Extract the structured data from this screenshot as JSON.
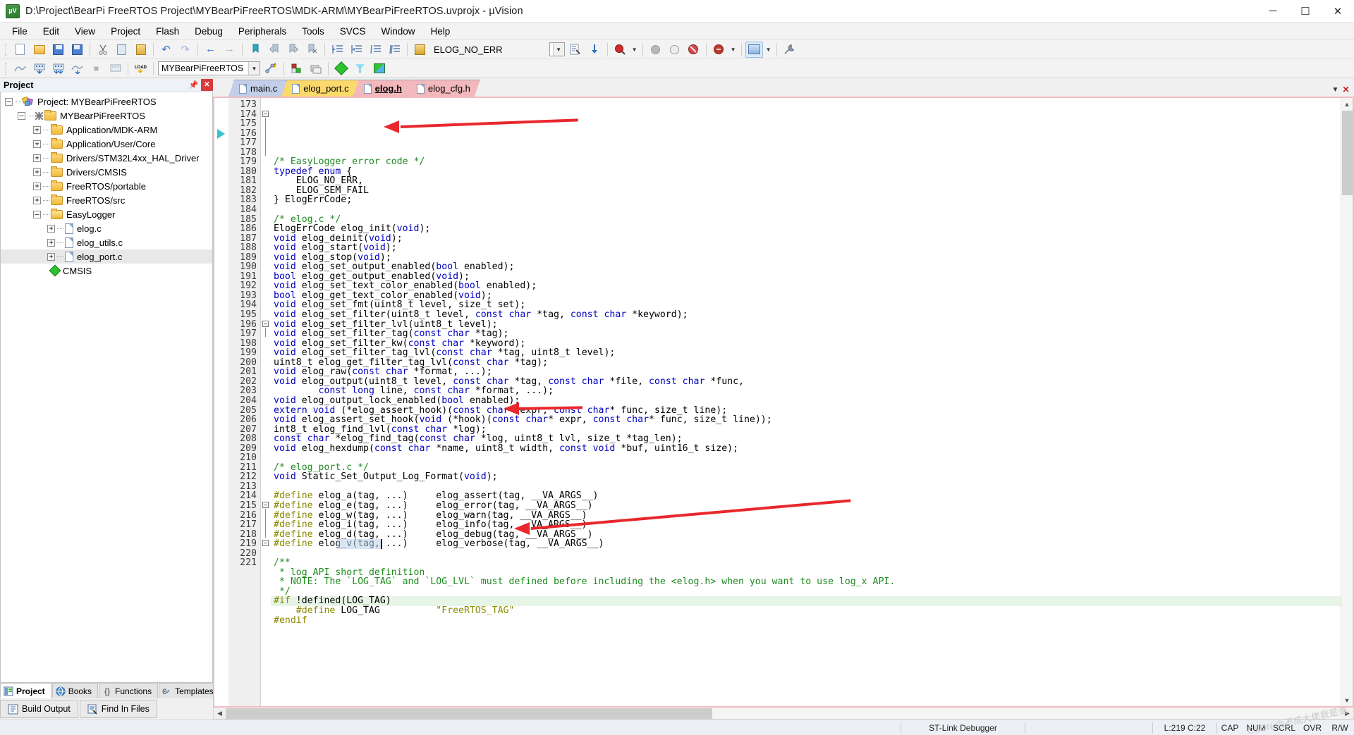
{
  "window": {
    "title": "D:\\Project\\BearPi FreeRTOS Project\\MYBearPiFreeRTOS\\MDK-ARM\\MYBearPiFreeRTOS.uvprojx - µVision",
    "app_icon": "uvision-icon",
    "minimize": "─",
    "maximize": "☐",
    "close": "✕"
  },
  "menu": {
    "items": [
      "File",
      "Edit",
      "View",
      "Project",
      "Flash",
      "Debug",
      "Peripherals",
      "Tools",
      "SVCS",
      "Window",
      "Help"
    ]
  },
  "toolbar1": {
    "find_combo_value": "ELOG_NO_ERR",
    "buttons": [
      "new-file-icon",
      "open-file-icon",
      "save-icon",
      "save-all-icon",
      "cut-icon",
      "copy-icon",
      "paste-icon",
      "undo-icon",
      "redo-icon",
      "navigate-back-icon",
      "navigate-forward-icon",
      "insert-bookmark-icon",
      "prev-bookmark-icon",
      "next-bookmark-icon",
      "clear-bookmarks-icon",
      "indent-icon",
      "outdent-icon",
      "comment-icon",
      "uncomment-icon",
      "find-in-files-icon"
    ],
    "right_buttons": [
      "bookmark-list-icon",
      "jump-icon",
      "magnifier-icon",
      "dropdown-caret-icon",
      "breakpoint-disabled-icon",
      "breakpoint-empty-icon",
      "breakpoint-kill-icon",
      "debug-icon",
      "window-layout-icon",
      "configure-icon"
    ]
  },
  "toolbar2": {
    "target_combo_value": "MYBearPiFreeRTOS",
    "buttons": [
      "translate-icon",
      "build-icon",
      "rebuild-icon",
      "batch-build-icon",
      "stop-build-icon",
      "download-icon",
      "target-options-icon",
      "manage-runtime-icon",
      "debug-start-icon",
      "registers-icon",
      "diamond-green-icon",
      "funnel-icon",
      "multi-project-icon"
    ]
  },
  "project_panel": {
    "header": "Project",
    "pin_icon": "pin-icon",
    "close_icon": "close-icon",
    "tree": [
      {
        "label": "Project: MYBearPiFreeRTOS",
        "depth": 0,
        "expander": "-",
        "icon": "project-icon"
      },
      {
        "label": "MYBearPiFreeRTOS",
        "depth": 1,
        "expander": "-",
        "icon": "target-folder-icon"
      },
      {
        "label": "Application/MDK-ARM",
        "depth": 2,
        "expander": "+",
        "icon": "folder-icon"
      },
      {
        "label": "Application/User/Core",
        "depth": 2,
        "expander": "+",
        "icon": "folder-icon"
      },
      {
        "label": "Drivers/STM32L4xx_HAL_Driver",
        "depth": 2,
        "expander": "+",
        "icon": "folder-icon"
      },
      {
        "label": "Drivers/CMSIS",
        "depth": 2,
        "expander": "+",
        "icon": "folder-icon"
      },
      {
        "label": "FreeRTOS/portable",
        "depth": 2,
        "expander": "+",
        "icon": "folder-icon"
      },
      {
        "label": "FreeRTOS/src",
        "depth": 2,
        "expander": "+",
        "icon": "folder-icon"
      },
      {
        "label": "EasyLogger",
        "depth": 2,
        "expander": "-",
        "icon": "folder-open-icon"
      },
      {
        "label": "elog.c",
        "depth": 3,
        "expander": "+",
        "icon": "file-icon"
      },
      {
        "label": "elog_utils.c",
        "depth": 3,
        "expander": "+",
        "icon": "file-icon"
      },
      {
        "label": "elog_port.c",
        "depth": 3,
        "expander": "+",
        "icon": "file-icon",
        "selected": true
      },
      {
        "label": "CMSIS",
        "depth": 2,
        "expander": "",
        "icon": "cmsis-icon"
      }
    ],
    "bottom_tabs": [
      {
        "label": "Project",
        "icon": "project-tab-icon",
        "active": true
      },
      {
        "label": "Books",
        "icon": "books-tab-icon",
        "active": false
      },
      {
        "label": "Functions",
        "icon": "functions-tab-icon",
        "active": false
      },
      {
        "label": "Templates",
        "icon": "templates-tab-icon",
        "active": false
      }
    ]
  },
  "editor": {
    "tabs": [
      {
        "label": "main.c",
        "state": "inactive",
        "color": "#c3cfe8"
      },
      {
        "label": "elog_port.c",
        "state": "inactive",
        "color": "#fbd96b"
      },
      {
        "label": "elog.h",
        "state": "active",
        "color": "#f2b8bc"
      },
      {
        "label": "elog_cfg.h",
        "state": "inactive",
        "color": "#f2b8bc"
      }
    ],
    "tab_nav": {
      "down": "▼",
      "close": "✕"
    },
    "first_line": 173,
    "highlight_line": 219,
    "lines": [
      {
        "n": 173,
        "tokens": [
          [
            "cm",
            "/* EasyLogger error code */"
          ]
        ]
      },
      {
        "n": 174,
        "fold": "-",
        "tokens": [
          [
            "kw",
            "typedef"
          ],
          [
            "pl",
            " "
          ],
          [
            "kw",
            "enum"
          ],
          [
            "pl",
            " {"
          ]
        ]
      },
      {
        "n": 175,
        "tokens": [
          [
            "pl",
            "    ELOG_NO_ERR,"
          ]
        ]
      },
      {
        "n": 176,
        "tokens": [
          [
            "pl",
            "    ELOG_SEM_FAIL"
          ]
        ]
      },
      {
        "n": 177,
        "tokens": [
          [
            "pl",
            "} ElogErrCode;"
          ]
        ]
      },
      {
        "n": 178,
        "tokens": []
      },
      {
        "n": 179,
        "tokens": [
          [
            "cm",
            "/* elog.c */"
          ]
        ]
      },
      {
        "n": 180,
        "tokens": [
          [
            "pl",
            "ElogErrCode elog_init("
          ],
          [
            "kw",
            "void"
          ],
          [
            "pl",
            ");"
          ]
        ]
      },
      {
        "n": 181,
        "tokens": [
          [
            "kw",
            "void"
          ],
          [
            "pl",
            " elog_deinit("
          ],
          [
            "kw",
            "void"
          ],
          [
            "pl",
            ");"
          ]
        ]
      },
      {
        "n": 182,
        "tokens": [
          [
            "kw",
            "void"
          ],
          [
            "pl",
            " elog_start("
          ],
          [
            "kw",
            "void"
          ],
          [
            "pl",
            ");"
          ]
        ]
      },
      {
        "n": 183,
        "tokens": [
          [
            "kw",
            "void"
          ],
          [
            "pl",
            " elog_stop("
          ],
          [
            "kw",
            "void"
          ],
          [
            "pl",
            ");"
          ]
        ]
      },
      {
        "n": 184,
        "tokens": [
          [
            "kw",
            "void"
          ],
          [
            "pl",
            " elog_set_output_enabled("
          ],
          [
            "kw",
            "bool"
          ],
          [
            "pl",
            " enabled);"
          ]
        ]
      },
      {
        "n": 185,
        "tokens": [
          [
            "kw",
            "bool"
          ],
          [
            "pl",
            " elog_get_output_enabled("
          ],
          [
            "kw",
            "void"
          ],
          [
            "pl",
            ");"
          ]
        ]
      },
      {
        "n": 186,
        "tokens": [
          [
            "kw",
            "void"
          ],
          [
            "pl",
            " elog_set_text_color_enabled("
          ],
          [
            "kw",
            "bool"
          ],
          [
            "pl",
            " enabled);"
          ]
        ]
      },
      {
        "n": 187,
        "tokens": [
          [
            "kw",
            "bool"
          ],
          [
            "pl",
            " elog_get_text_color_enabled("
          ],
          [
            "kw",
            "void"
          ],
          [
            "pl",
            ");"
          ]
        ]
      },
      {
        "n": 188,
        "tokens": [
          [
            "kw",
            "void"
          ],
          [
            "pl",
            " elog_set_fmt(uint8_t level, size_t set);"
          ]
        ]
      },
      {
        "n": 189,
        "tokens": [
          [
            "kw",
            "void"
          ],
          [
            "pl",
            " elog_set_filter(uint8_t level, "
          ],
          [
            "kw",
            "const char"
          ],
          [
            "pl",
            " *tag, "
          ],
          [
            "kw",
            "const char"
          ],
          [
            "pl",
            " *keyword);"
          ]
        ]
      },
      {
        "n": 190,
        "tokens": [
          [
            "kw",
            "void"
          ],
          [
            "pl",
            " elog_set_filter_lvl(uint8_t level);"
          ]
        ]
      },
      {
        "n": 191,
        "tokens": [
          [
            "kw",
            "void"
          ],
          [
            "pl",
            " elog_set_filter_tag("
          ],
          [
            "kw",
            "const char"
          ],
          [
            "pl",
            " *tag);"
          ]
        ]
      },
      {
        "n": 192,
        "tokens": [
          [
            "kw",
            "void"
          ],
          [
            "pl",
            " elog_set_filter_kw("
          ],
          [
            "kw",
            "const char"
          ],
          [
            "pl",
            " *keyword);"
          ]
        ]
      },
      {
        "n": 193,
        "tokens": [
          [
            "kw",
            "void"
          ],
          [
            "pl",
            " elog_set_filter_tag_lvl("
          ],
          [
            "kw",
            "const char"
          ],
          [
            "pl",
            " *tag, uint8_t level);"
          ]
        ]
      },
      {
        "n": 194,
        "tokens": [
          [
            "pl",
            "uint8_t elog_get_filter_tag_lvl("
          ],
          [
            "kw",
            "const char"
          ],
          [
            "pl",
            " *tag);"
          ]
        ]
      },
      {
        "n": 195,
        "tokens": [
          [
            "kw",
            "void"
          ],
          [
            "pl",
            " elog_raw("
          ],
          [
            "kw",
            "const char"
          ],
          [
            "pl",
            " *format, ...);"
          ]
        ]
      },
      {
        "n": 196,
        "fold": "-",
        "tokens": [
          [
            "kw",
            "void"
          ],
          [
            "pl",
            " elog_output(uint8_t level, "
          ],
          [
            "kw",
            "const char"
          ],
          [
            "pl",
            " *tag, "
          ],
          [
            "kw",
            "const char"
          ],
          [
            "pl",
            " *file, "
          ],
          [
            "kw",
            "const char"
          ],
          [
            "pl",
            " *func,"
          ]
        ]
      },
      {
        "n": 197,
        "tokens": [
          [
            "pl",
            "        "
          ],
          [
            "kw",
            "const long"
          ],
          [
            "pl",
            " line, "
          ],
          [
            "kw",
            "const char"
          ],
          [
            "pl",
            " *format, ...);"
          ]
        ]
      },
      {
        "n": 198,
        "tokens": [
          [
            "kw",
            "void"
          ],
          [
            "pl",
            " elog_output_lock_enabled("
          ],
          [
            "kw",
            "bool"
          ],
          [
            "pl",
            " enabled);"
          ]
        ]
      },
      {
        "n": 199,
        "tokens": [
          [
            "kw",
            "extern void"
          ],
          [
            "pl",
            " (*elog_assert_hook)("
          ],
          [
            "kw",
            "const char"
          ],
          [
            "pl",
            "* expr, "
          ],
          [
            "kw",
            "const char"
          ],
          [
            "pl",
            "* func, size_t line);"
          ]
        ]
      },
      {
        "n": 200,
        "tokens": [
          [
            "kw",
            "void"
          ],
          [
            "pl",
            " elog_assert_set_hook("
          ],
          [
            "kw",
            "void"
          ],
          [
            "pl",
            " (*hook)("
          ],
          [
            "kw",
            "const char"
          ],
          [
            "pl",
            "* expr, "
          ],
          [
            "kw",
            "const char"
          ],
          [
            "pl",
            "* func, size_t line));"
          ]
        ]
      },
      {
        "n": 201,
        "tokens": [
          [
            "pl",
            "int8_t elog_find_lvl("
          ],
          [
            "kw",
            "const char"
          ],
          [
            "pl",
            " *log);"
          ]
        ]
      },
      {
        "n": 202,
        "tokens": [
          [
            "kw",
            "const char"
          ],
          [
            "pl",
            " *elog_find_tag("
          ],
          [
            "kw",
            "const char"
          ],
          [
            "pl",
            " *log, uint8_t lvl, size_t *tag_len);"
          ]
        ]
      },
      {
        "n": 203,
        "tokens": [
          [
            "kw",
            "void"
          ],
          [
            "pl",
            " elog_hexdump("
          ],
          [
            "kw",
            "const char"
          ],
          [
            "pl",
            " *name, uint8_t width, "
          ],
          [
            "kw",
            "const void"
          ],
          [
            "pl",
            " *buf, uint16_t size);"
          ]
        ]
      },
      {
        "n": 204,
        "tokens": []
      },
      {
        "n": 205,
        "tokens": [
          [
            "cm",
            "/* elog_port.c */"
          ]
        ]
      },
      {
        "n": 206,
        "tokens": [
          [
            "kw",
            "void"
          ],
          [
            "pl",
            " Static_Set_Output_Log_Format("
          ],
          [
            "kw",
            "void"
          ],
          [
            "pl",
            ");"
          ]
        ]
      },
      {
        "n": 207,
        "tokens": []
      },
      {
        "n": 208,
        "tokens": [
          [
            "pp",
            "#define"
          ],
          [
            "pl",
            " elog_a(tag, ...)     elog_assert(tag, __VA_ARGS__)"
          ]
        ]
      },
      {
        "n": 209,
        "tokens": [
          [
            "pp",
            "#define"
          ],
          [
            "pl",
            " elog_e(tag, ...)     elog_error(tag, __VA_ARGS__)"
          ]
        ]
      },
      {
        "n": 210,
        "tokens": [
          [
            "pp",
            "#define"
          ],
          [
            "pl",
            " elog_w(tag, ...)     elog_warn(tag, __VA_ARGS__)"
          ]
        ]
      },
      {
        "n": 211,
        "tokens": [
          [
            "pp",
            "#define"
          ],
          [
            "pl",
            " elog_i(tag, ...)     elog_info(tag, __VA_ARGS__)"
          ]
        ]
      },
      {
        "n": 212,
        "tokens": [
          [
            "pp",
            "#define"
          ],
          [
            "pl",
            " elog_d(tag, ...)     elog_debug(tag, __VA_ARGS__)"
          ]
        ]
      },
      {
        "n": 213,
        "tokens": [
          [
            "pp",
            "#define"
          ],
          [
            "pl",
            " elog_v(tag, ...)     elog_verbose(tag, __VA_ARGS__)"
          ]
        ]
      },
      {
        "n": 214,
        "tokens": []
      },
      {
        "n": 215,
        "fold": "-",
        "tokens": [
          [
            "cm",
            "/**"
          ]
        ]
      },
      {
        "n": 216,
        "tokens": [
          [
            "cm",
            " * log API short definition"
          ]
        ]
      },
      {
        "n": 217,
        "tokens": [
          [
            "cm",
            " * NOTE: The `LOG_TAG` and `LOG_LVL` must defined before including the <elog.h> when you want to use log_x API."
          ]
        ]
      },
      {
        "n": 218,
        "tokens": [
          [
            "cm",
            " */"
          ]
        ]
      },
      {
        "n": 219,
        "fold": "-",
        "highlight": true,
        "tokens": [
          [
            "pp",
            "#if"
          ],
          [
            "pl",
            " !defined(LOG_TAG)"
          ]
        ]
      },
      {
        "n": 220,
        "tokens": [
          [
            "pp",
            "    #define"
          ],
          [
            "pl",
            " LOG_TAG          "
          ],
          [
            "str",
            "\"FreeRTOS_TAG\""
          ]
        ]
      },
      {
        "n": 221,
        "tokens": [
          [
            "pp",
            "#endif"
          ]
        ]
      }
    ],
    "annotations": [
      {
        "name": "arrow-elog-sem-fail",
        "target_line": 176
      },
      {
        "name": "arrow-static-set-output-log-format",
        "target_line": 206
      },
      {
        "name": "arrow-log-tag-define",
        "target_line": 220
      }
    ]
  },
  "bottom_panel": {
    "tabs": [
      {
        "label": "Build Output",
        "icon": "build-output-icon"
      },
      {
        "label": "Find In Files",
        "icon": "find-in-files-icon"
      }
    ]
  },
  "statusbar": {
    "debugger": "ST-Link Debugger",
    "position": "L:219 C:22",
    "indicators": [
      "CAP",
      "NUM",
      "SCRL",
      "OVR",
      "R/W"
    ]
  },
  "watermark": "CSDN @不成大佬我是谁"
}
